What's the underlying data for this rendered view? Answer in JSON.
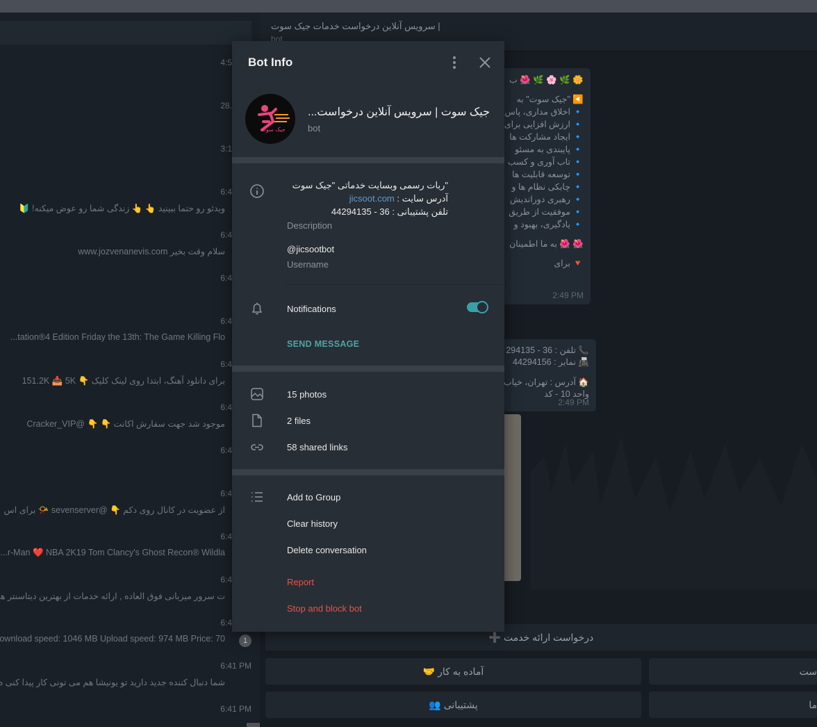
{
  "chat_list": {
    "rows": [
      {
        "time": "4:5",
        "text": ""
      },
      {
        "time": "28.",
        "text": ""
      },
      {
        "time": "3:1",
        "text": ""
      },
      {
        "time": "6:4",
        "text": "ویدئو رو حتما ببینید 👆 👆 زندگی شما رو عوض میکنه! 🔰"
      },
      {
        "time": "6:4",
        "text": "سلام وقت بخیر www.jozvenanevis.com"
      },
      {
        "time": "6:4",
        "text": ""
      },
      {
        "time": "6:4",
        "text": "tation®4 Edition Friday the 13th: The Game Killing Flo..."
      },
      {
        "time": "6:4",
        "text": "برای دانلود آهنگ، ابتدا روی لینک کلیک 👇 151.2K 📥 5K"
      },
      {
        "time": "6:4",
        "text": "موجود شد جهت سفارش اکانت 👇 👇 @Cracker_VIP"
      },
      {
        "time": "6:4",
        "text": ""
      },
      {
        "time": "6:4",
        "text": "از عضویت در کانال روی دکم 👇 @sevenserver 📯 برای اس"
      },
      {
        "time": "6:4",
        "text": "r-Man ❤️ NBA 2K19 Tom Clancy's Ghost Recon® Wildla..."
      },
      {
        "time": "6:4",
        "text": "ت سرور میزبانی فوق العاده , ارائه خدمات از بهترین دیتاسنتر هلن"
      },
      {
        "time": "6:4",
        "text": "ownload speed: 1046 MB Upload speed: 974 MB  Price: 70...."
      },
      {
        "time": "6:41 PM",
        "text": "شما دنبال کننده جدید دارید  تو یونیشا هم می تونی کار پیدا کنی ه"
      },
      {
        "time": "6:41 PM",
        "text": ""
      }
    ],
    "badge": "1"
  },
  "chat": {
    "title": "سرویس آنلاین درخواست خدمات جیک سوت |",
    "subtitle": "bot",
    "msg1_lines": [
      "🌼 🌿 🌸 🌿 🌺 ب",
      "◀️ \"جیک سوت\" به",
      "🔹 اخلاق مداری، پاس",
      "🔹 ارزش افزایی برای",
      "🔹 ایجاد مشارکت ها",
      "🔹 پایبندی به مسئو",
      "🔹 تاب آوری و کسب",
      "🔹 توسعه قابلیت ها",
      "🔹 چابکی نظام ها و",
      "🔹 رهبری دوراندیش",
      "🔹 موفقیت از طریق",
      "🔹 یادگیری، بهبود و",
      "🌺 🌺 به ما اطمینان",
      "🔻 برای"
    ],
    "msg1_time": "2:49 PM",
    "msg2_lines": [
      "📞 تلفن : 36 - 294135",
      "📠 نمابر : 44294156",
      "🏠 آدرس : تهران، خیاب",
      "واحد 10 - کد"
    ],
    "msg2_time": "2:49 PM",
    "keyboard": {
      "wide": "➕ درخواست ارائه خدمت",
      "btn1": "🤝 آماده به کار",
      "btn2": "ست",
      "btn3": "👥 پشتیبانی",
      "btn4": "ما"
    }
  },
  "modal": {
    "title": "Bot Info",
    "bot_name": "جیک سوت | سرویس آنلاین درخواست...",
    "bot_status": "bot",
    "avatar_text": "جیک سوت",
    "description_lines": {
      "line1": "\"ربات رسمی وبسایت خدماتی \"جیک سوت",
      "line2_prefix": "آدرس سایت : ",
      "line2_link": "jicsoot.com",
      "line3": "تلفن پشتیبانی : 36 - 44294135"
    },
    "description_label": "Description",
    "username": "@jicsootbot",
    "username_label": "Username",
    "notifications_label": "Notifications",
    "notifications_on": true,
    "send_message": "SEND MESSAGE",
    "media": {
      "photos": "15 photos",
      "files": "2 files",
      "links": "58 shared links"
    },
    "actions": {
      "add_to_group": "Add to Group",
      "clear_history": "Clear history",
      "delete_conversation": "Delete conversation",
      "report": "Report",
      "stop_block": "Stop and block bot"
    },
    "colors": {
      "accent": "#3aa0a8",
      "danger": "#e5534b",
      "link": "#5f99d4"
    }
  }
}
